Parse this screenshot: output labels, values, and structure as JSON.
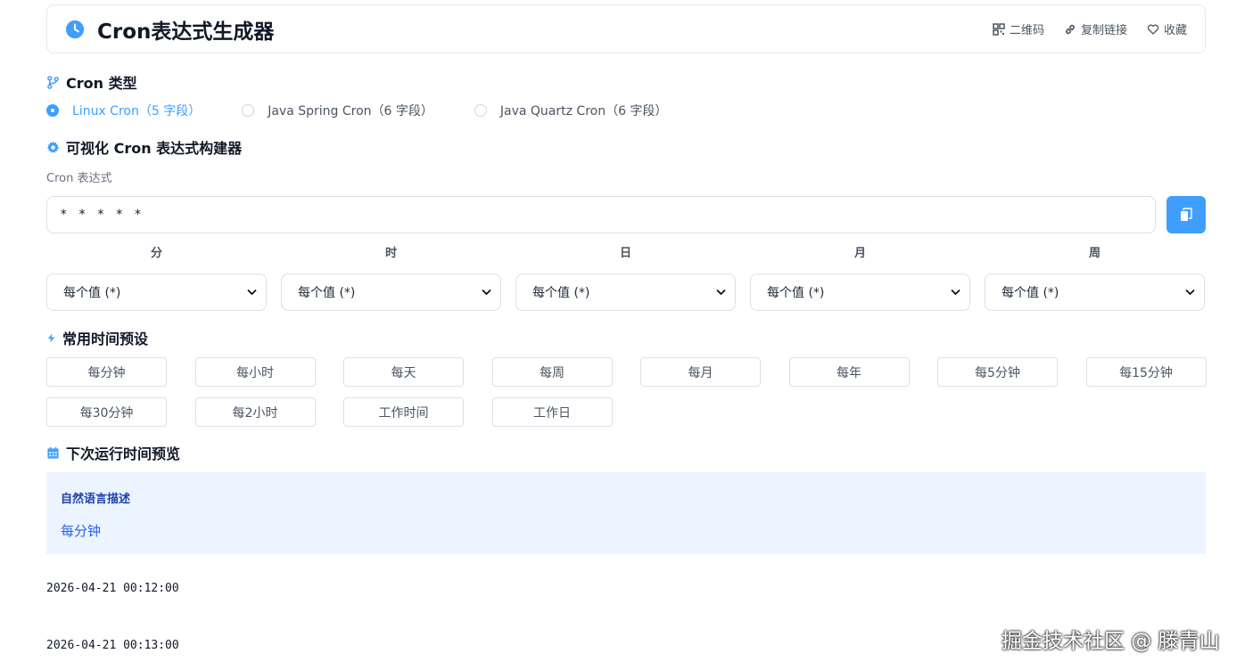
{
  "header": {
    "title": "Cron表达式生成器",
    "actions": [
      {
        "label": "二维码"
      },
      {
        "label": "复制链接"
      },
      {
        "label": "收藏"
      }
    ]
  },
  "cron_type": {
    "title": "Cron 类型",
    "options": [
      {
        "label": "Linux Cron（5 字段）",
        "checked": true
      },
      {
        "label": "Java Spring Cron（6 字段）",
        "checked": false
      },
      {
        "label": "Java Quartz Cron（6 字段）",
        "checked": false
      }
    ]
  },
  "builder": {
    "title": "可视化 Cron 表达式构建器",
    "expression_label": "Cron 表达式",
    "expression_value": "* * * * *",
    "fields": [
      {
        "label": "分",
        "value": "每个值 (*)"
      },
      {
        "label": "时",
        "value": "每个值 (*)"
      },
      {
        "label": "日",
        "value": "每个值 (*)"
      },
      {
        "label": "月",
        "value": "每个值 (*)"
      },
      {
        "label": "周",
        "value": "每个值 (*)"
      }
    ]
  },
  "presets": {
    "title": "常用时间预设",
    "items": [
      "每分钟",
      "每小时",
      "每天",
      "每周",
      "每月",
      "每年",
      "每5分钟",
      "每15分钟",
      "每30分钟",
      "每2小时",
      "工作时间",
      "工作日"
    ]
  },
  "preview": {
    "title": "下次运行时间预览",
    "desc_label": "自然语言描述",
    "desc_text": "每分钟",
    "times": [
      "2026-04-21 00:12:00",
      "2026-04-21 00:13:00"
    ]
  },
  "watermark": "掘金技术社区 @ 滕青山",
  "colors": {
    "accent": "#409eff",
    "desc_bg": "#ecf5ff"
  }
}
